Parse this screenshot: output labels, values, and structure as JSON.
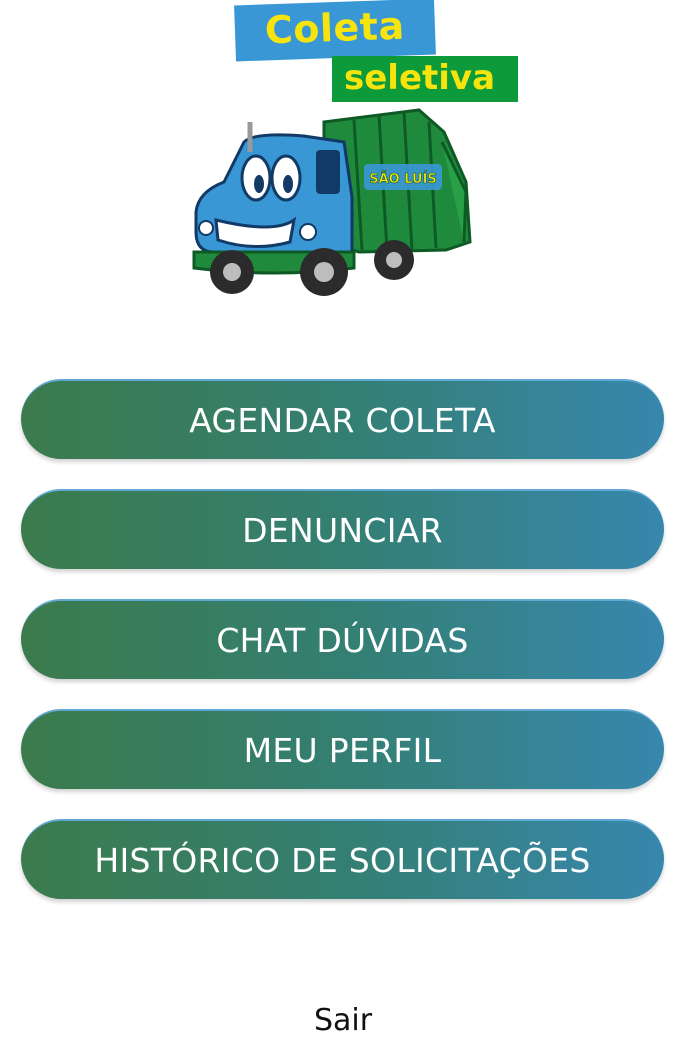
{
  "logo": {
    "line1": "Coleta",
    "line2": "seletiva",
    "truck_badge": "SÃO LUÍS"
  },
  "menu": {
    "items": [
      {
        "label": "AGENDAR COLETA"
      },
      {
        "label": "DENUNCIAR"
      },
      {
        "label": "CHAT DÚVIDAS"
      },
      {
        "label": "MEU PERFIL"
      },
      {
        "label": "HISTÓRICO DE SOLICITAÇÕES"
      }
    ]
  },
  "footer": {
    "logout_label": "Sair"
  },
  "colors": {
    "button_gradient_start": "#3b7b4c",
    "button_gradient_end": "#3787ad",
    "logo_blue": "#3a97d6",
    "logo_green": "#0c9a3a",
    "logo_text_yellow": "#f6e40c"
  }
}
